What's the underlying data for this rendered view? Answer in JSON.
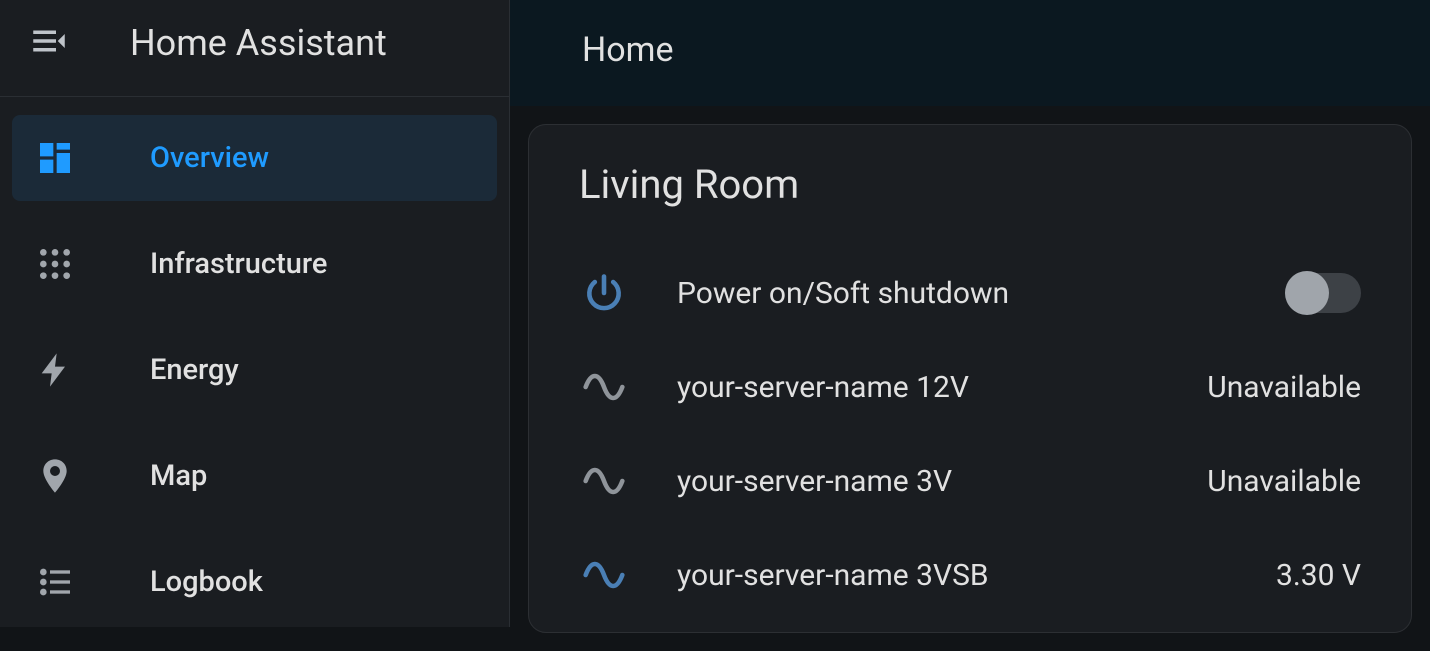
{
  "app_title": "Home Assistant",
  "sidebar": {
    "items": [
      {
        "label": "Overview",
        "icon": "dashboard-icon",
        "active": true
      },
      {
        "label": "Infrastructure",
        "icon": "grid-icon",
        "active": false
      },
      {
        "label": "Energy",
        "icon": "bolt-icon",
        "active": false
      },
      {
        "label": "Map",
        "icon": "map-pin-icon",
        "active": false
      },
      {
        "label": "Logbook",
        "icon": "list-icon",
        "active": false
      }
    ]
  },
  "header": {
    "title": "Home"
  },
  "card": {
    "title": "Living Room",
    "entities": [
      {
        "icon": "power-icon",
        "accent": true,
        "label": "Power on/Soft shutdown",
        "control": "toggle",
        "toggle_state": "off"
      },
      {
        "icon": "sine-icon",
        "accent": false,
        "label": "your-server-name 12V",
        "control": "value",
        "value": "Unavailable"
      },
      {
        "icon": "sine-icon",
        "accent": false,
        "label": "your-server-name 3V",
        "control": "value",
        "value": "Unavailable"
      },
      {
        "icon": "sine-icon",
        "accent": true,
        "label": "your-server-name 3VSB",
        "control": "value",
        "value": "3.30 V"
      }
    ]
  }
}
